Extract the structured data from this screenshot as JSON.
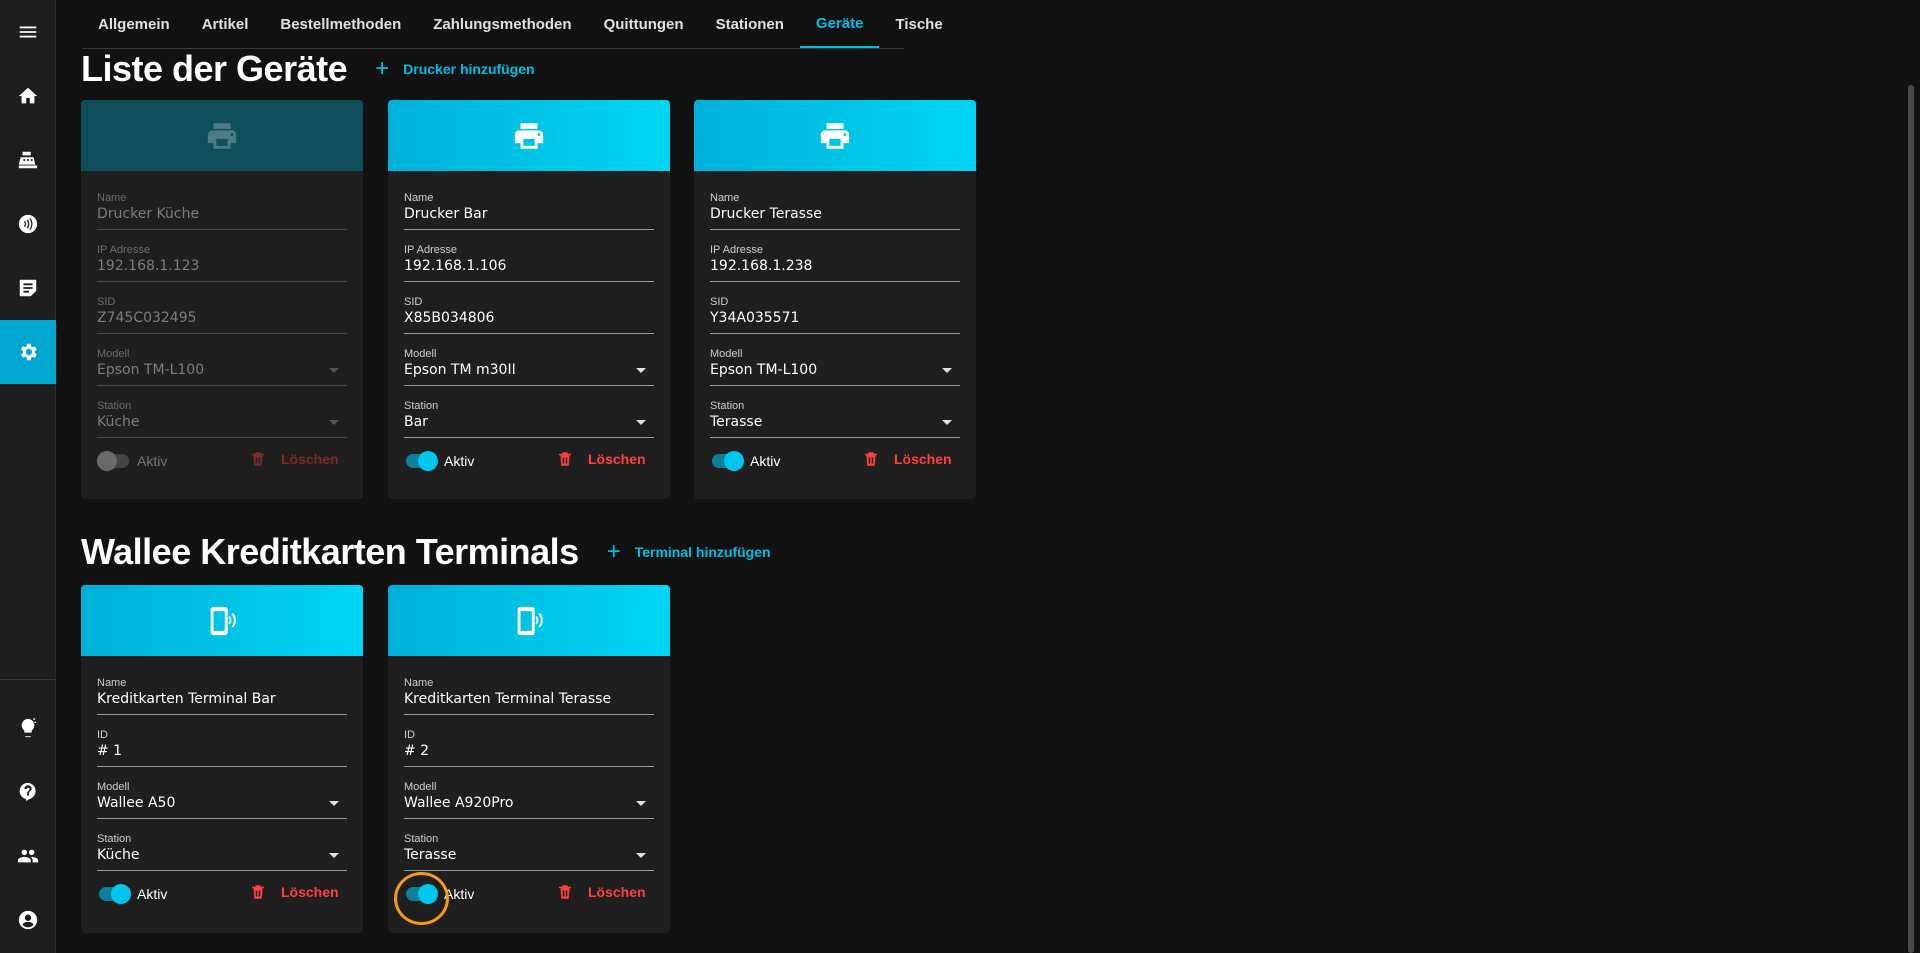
{
  "tabs": [
    {
      "label": "Allgemein"
    },
    {
      "label": "Artikel"
    },
    {
      "label": "Bestellmethoden"
    },
    {
      "label": "Zahlungsmethoden"
    },
    {
      "label": "Quittungen"
    },
    {
      "label": "Stationen"
    },
    {
      "label": "Geräte",
      "active": true
    },
    {
      "label": "Tische"
    }
  ],
  "sidebar": {
    "items": [
      {
        "icon": "menu-icon"
      },
      {
        "icon": "home-icon"
      },
      {
        "icon": "cash-register-icon"
      },
      {
        "icon": "contactless-icon"
      },
      {
        "icon": "order-list-icon"
      },
      {
        "icon": "settings-icon",
        "active": true
      },
      {
        "icon": "lightbulb-icon"
      },
      {
        "icon": "help-icon"
      },
      {
        "icon": "users-icon"
      },
      {
        "icon": "account-icon"
      }
    ]
  },
  "printers_section": {
    "title": "Liste der Geräte",
    "add_label": "Drucker hinzufügen",
    "cards": [
      {
        "icon": "printer-icon",
        "active": false,
        "fields": [
          {
            "label": "Name",
            "value": "Drucker Küche"
          },
          {
            "label": "IP Adresse",
            "value": "192.168.1.123"
          },
          {
            "label": "SID",
            "value": "Z745C032495"
          },
          {
            "label": "Modell",
            "value": "Epson TM-L100"
          },
          {
            "label": "Station",
            "value": "Küche"
          }
        ],
        "toggle_label": "Aktiv",
        "delete_label": "Löschen"
      },
      {
        "icon": "printer-icon",
        "active": true,
        "fields": [
          {
            "label": "Name",
            "value": "Drucker Bar"
          },
          {
            "label": "IP Adresse",
            "value": "192.168.1.106"
          },
          {
            "label": "SID",
            "value": "X85B034806"
          },
          {
            "label": "Modell",
            "value": "Epson TM m30II"
          },
          {
            "label": "Station",
            "value": "Bar"
          }
        ],
        "toggle_label": "Aktiv",
        "delete_label": "Löschen"
      },
      {
        "icon": "printer-icon",
        "active": true,
        "fields": [
          {
            "label": "Name",
            "value": "Drucker Terasse"
          },
          {
            "label": "IP Adresse",
            "value": "192.168.1.238"
          },
          {
            "label": "SID",
            "value": "Y34A035571"
          },
          {
            "label": "Modell",
            "value": "Epson TM-L100"
          },
          {
            "label": "Station",
            "value": "Terasse"
          }
        ],
        "toggle_label": "Aktiv",
        "delete_label": "Löschen"
      }
    ]
  },
  "terminals_section": {
    "title": "Wallee Kreditkarten Terminals",
    "add_label": "Terminal hinzufügen",
    "cards": [
      {
        "icon": "payment-terminal-icon",
        "active": true,
        "fields": [
          {
            "label": "Name",
            "value": "Kreditkarten Terminal Bar"
          },
          {
            "label": "ID",
            "value": "# 1"
          },
          {
            "label": "Modell",
            "value": "Wallee A50"
          },
          {
            "label": "Station",
            "value": "Küche"
          }
        ],
        "toggle_label": "Aktiv",
        "delete_label": "Löschen"
      },
      {
        "icon": "payment-terminal-icon",
        "active": true,
        "fields": [
          {
            "label": "Name",
            "value": "Kreditkarten Terminal Terasse"
          },
          {
            "label": "ID",
            "value": "# 2"
          },
          {
            "label": "Modell",
            "value": "Wallee A920Pro"
          },
          {
            "label": "Station",
            "value": "Terasse"
          }
        ],
        "toggle_label": "Aktiv",
        "delete_label": "Löschen"
      }
    ]
  },
  "colors": {
    "accent": "#00bfe6",
    "delete": "#ff4040",
    "highlight": "#f59b14"
  }
}
